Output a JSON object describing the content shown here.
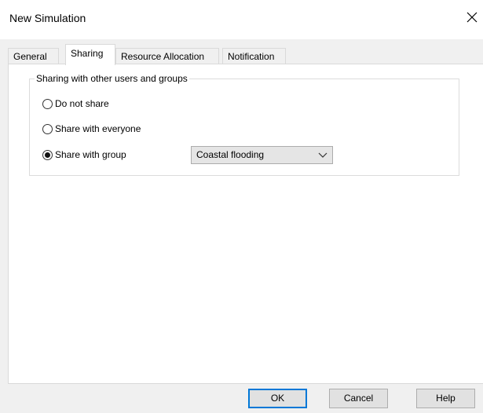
{
  "window": {
    "title": "New Simulation"
  },
  "tabs": [
    {
      "label": "General"
    },
    {
      "label": "Sharing"
    },
    {
      "label": "Resource Allocation"
    },
    {
      "label": "Notification"
    }
  ],
  "active_tab": "Sharing",
  "sharing": {
    "group_label": "Sharing with other users and groups",
    "options": [
      {
        "label": "Do not share",
        "checked": false
      },
      {
        "label": "Share with everyone",
        "checked": false
      },
      {
        "label": "Share with group",
        "checked": true
      }
    ],
    "group_select": {
      "value": "Coastal flooding"
    }
  },
  "buttons": {
    "ok": "OK",
    "cancel": "Cancel",
    "help": "Help"
  },
  "colors": {
    "accent": "#0078d7",
    "panel": "#ffffff",
    "window": "#f0f0f0"
  },
  "icons": {
    "close": "close-icon",
    "dropdown": "chevron-down-icon"
  }
}
